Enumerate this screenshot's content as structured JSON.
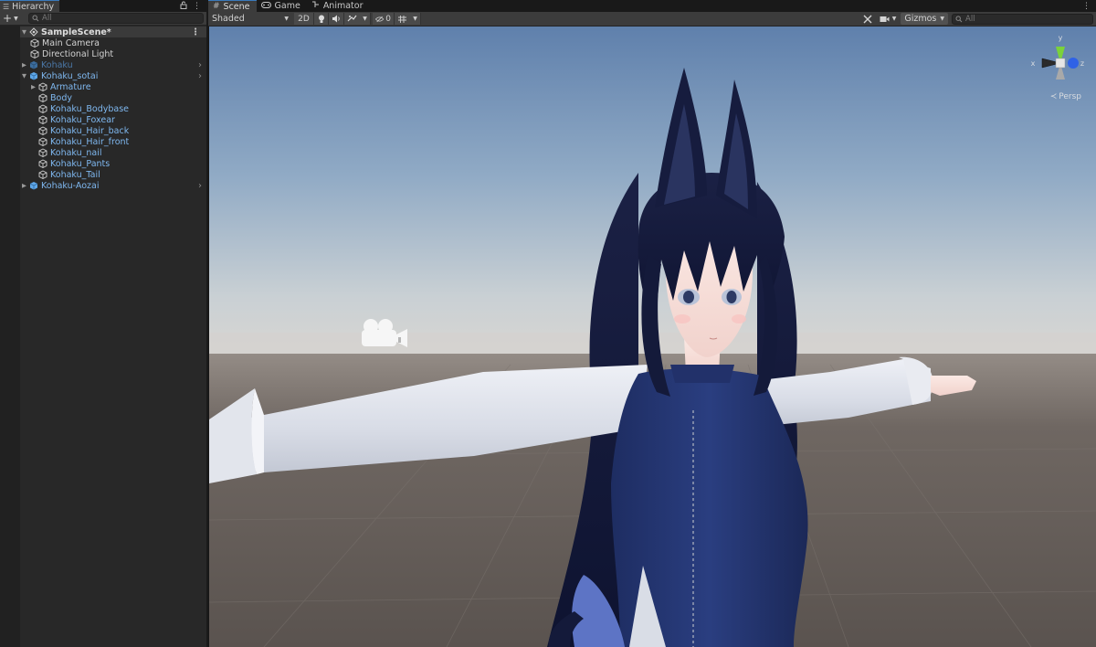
{
  "hierarchy": {
    "tab_label": "Hierarchy",
    "search_placeholder": "All",
    "rows": [
      {
        "label": "SampleScene*"
      },
      {
        "label": "Main Camera"
      },
      {
        "label": "Directional Light"
      },
      {
        "label": "Kohaku"
      },
      {
        "label": "Kohaku_sotai"
      },
      {
        "label": "Armature"
      },
      {
        "label": "Body"
      },
      {
        "label": "Kohaku_Bodybase"
      },
      {
        "label": "Kohaku_Foxear"
      },
      {
        "label": "Kohaku_Hair_back"
      },
      {
        "label": "Kohaku_Hair_front"
      },
      {
        "label": "Kohaku_nail"
      },
      {
        "label": "Kohaku_Pants"
      },
      {
        "label": "Kohaku_Tail"
      },
      {
        "label": "Kohaku-Aozai"
      }
    ]
  },
  "scene": {
    "tabs": [
      {
        "label": "Scene",
        "icon": "grid-icon"
      },
      {
        "label": "Game",
        "icon": "gamepad-icon"
      },
      {
        "label": "Animator",
        "icon": "animator-icon"
      }
    ],
    "toolbar": {
      "shading_mode": "Shaded",
      "mode_2d": "2D",
      "hidden_count": "0",
      "gizmos": "Gizmos",
      "search_placeholder": "All"
    },
    "orientation_gizmo": {
      "y_label": "y",
      "x_label": "x",
      "z_label": "z",
      "projection": "Persp",
      "colors": {
        "y": "#7bd23a",
        "x": "#e83a32",
        "z": "#2f62e6"
      }
    }
  }
}
